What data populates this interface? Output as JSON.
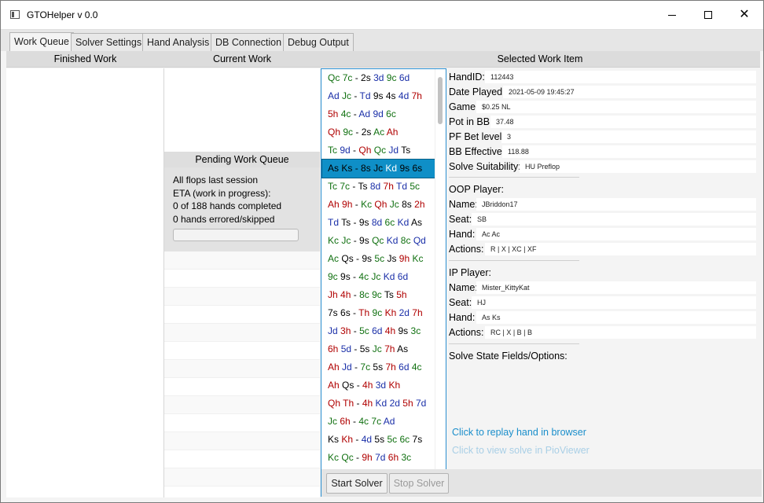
{
  "window": {
    "title": "GTOHelper v 0.0"
  },
  "tabs": [
    "Work Queue",
    "Solver Settings",
    "Hand Analysis",
    "DB Connection",
    "Debug Output"
  ],
  "columns": {
    "finished": "Finished Work",
    "current": "Current Work",
    "selected": "Selected Work Item"
  },
  "pending": {
    "header": "Pending Work Queue",
    "lines": [
      "All flops last session",
      "ETA (work in progress):",
      "0 of 188 hands completed",
      "0 hands errored/skipped"
    ],
    "progress": 0
  },
  "flops": [
    [
      "Qc",
      "7c",
      "2s",
      "3d",
      "9c",
      "6d"
    ],
    [
      "Ad",
      "Jc",
      "Td",
      "9s",
      "4s",
      "4d",
      "7h"
    ],
    [
      "5h",
      "4c",
      "Ad",
      "9d",
      "6c"
    ],
    [
      "Qh",
      "9c",
      "2s",
      "Ac",
      "Ah"
    ],
    [
      "Tc",
      "9d",
      "Qh",
      "Qc",
      "Jd",
      "Ts"
    ],
    [
      "As",
      "Ks",
      "8s",
      "Jc",
      "Kd",
      "9s",
      "6s"
    ],
    [
      "Tc",
      "7c",
      "Ts",
      "8d",
      "7h",
      "Td",
      "5c"
    ],
    [
      "Ah",
      "9h",
      "Kc",
      "Qh",
      "Jc",
      "8s",
      "2h"
    ],
    [
      "Td",
      "Ts",
      "9s",
      "8d",
      "6c",
      "Kd",
      "As"
    ],
    [
      "Kc",
      "Jc",
      "9s",
      "Qc",
      "Kd",
      "8c",
      "Qd"
    ],
    [
      "Ac",
      "Qs",
      "9s",
      "5c",
      "Js",
      "9h",
      "Kc"
    ],
    [
      "9c",
      "9s",
      "4c",
      "Jc",
      "Kd",
      "6d"
    ],
    [
      "Jh",
      "4h",
      "8c",
      "9c",
      "Ts",
      "5h"
    ],
    [
      "7s",
      "6s",
      "Th",
      "9c",
      "Kh",
      "2d",
      "7h"
    ],
    [
      "Jd",
      "3h",
      "5c",
      "6d",
      "4h",
      "9s",
      "3c"
    ],
    [
      "6h",
      "5d",
      "5s",
      "Jc",
      "7h",
      "As"
    ],
    [
      "Ah",
      "Jd",
      "7c",
      "5s",
      "7h",
      "6d",
      "4c"
    ],
    [
      "Ah",
      "Qs",
      "4h",
      "3d",
      "Kh"
    ],
    [
      "Qh",
      "Th",
      "4h",
      "Kd",
      "2d",
      "5h",
      "7d"
    ],
    [
      "Jc",
      "6h",
      "4c",
      "7c",
      "Ad"
    ],
    [
      "Ks",
      "Kh",
      "4d",
      "5s",
      "5c",
      "6c",
      "7s"
    ],
    [
      "Kc",
      "Qc",
      "9h",
      "7d",
      "6h",
      "3c"
    ]
  ],
  "selected_flop_index": 5,
  "suit_colors": {
    "s": "#000000",
    "h": "#b00000",
    "d": "#1a2fa8",
    "c": "#107010"
  },
  "detail": {
    "hand_id_label": "HandID:",
    "hand_id": "112443",
    "date_label": "Date Played:",
    "date": "2021-05-09 19:45:27",
    "game_label": "Game:",
    "game": "$0.25 NL",
    "pot_label": "Pot in BB:",
    "pot": "37.48",
    "pf_label": "PF Bet level:",
    "pf": "3",
    "bbeff_label": "BB Effective:",
    "bbeff": "118.88",
    "suit_label": "Solve Suitability:",
    "suit": "HU Preflop",
    "oop_title": "OOP Player:",
    "oop_name_label": "Name:",
    "oop_name": "JBriddon17",
    "oop_seat_label": "Seat:",
    "oop_seat": "SB",
    "oop_hand_label": "Hand:",
    "oop_hand": "Ac Ac",
    "oop_actions_label": "Actions:",
    "oop_actions": "R | X | XC | XF",
    "ip_title": "IP Player:",
    "ip_name_label": "Name:",
    "ip_name": "Mister_KittyKat",
    "ip_seat_label": "Seat:",
    "ip_seat": "HJ",
    "ip_hand_label": "Hand:",
    "ip_hand": "As Ks",
    "ip_actions_label": "Actions:",
    "ip_actions": "RC | X | B | B",
    "solve_fields_title": "Solve State Fields/Options:",
    "link_replay": "Click to replay hand in browser",
    "link_pio": "Click to view solve in PioViewer"
  },
  "solver": {
    "start_label": "Start Solver",
    "stop_label": "Stop Solver"
  }
}
